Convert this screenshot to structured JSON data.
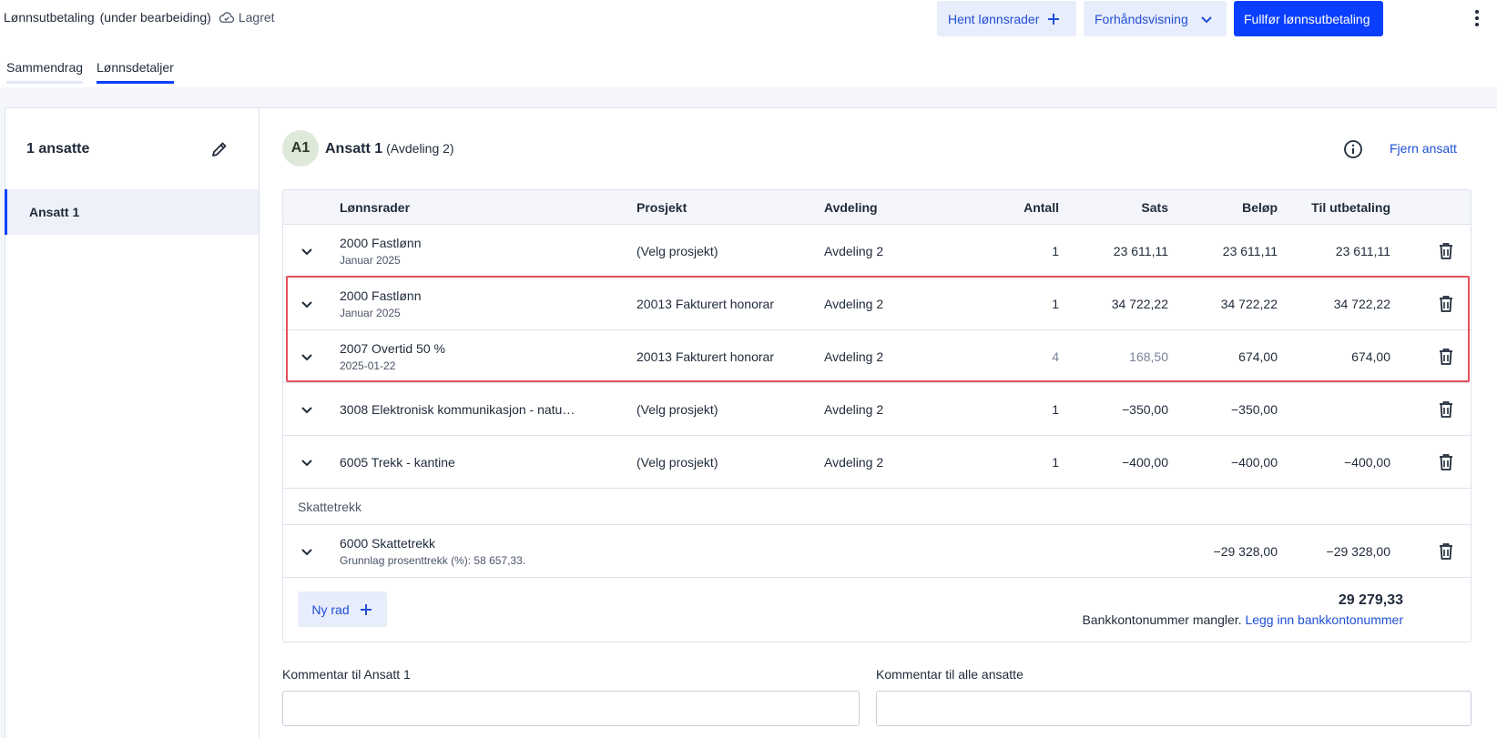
{
  "header": {
    "title": "Lønnsutbetaling",
    "title_status": "(under bearbeiding)",
    "save_status": "Lagret",
    "fetch_button": "Hent lønnsrader",
    "preview_button": "Forhåndsvisning",
    "finish_button": "Fullfør lønnsutbetaling"
  },
  "tabs": [
    {
      "label": "Sammendrag",
      "active": false
    },
    {
      "label": "Lønnsdetaljer",
      "active": true
    }
  ],
  "sidebar": {
    "count_label": "1 ansatte",
    "items": [
      {
        "label": "Ansatt 1",
        "selected": true
      }
    ]
  },
  "employee": {
    "initials": "A1",
    "name": "Ansatt 1",
    "department": "(Avdeling 2)",
    "remove_label": "Fjern ansatt"
  },
  "table": {
    "columns": [
      "Lønnsrader",
      "Prosjekt",
      "Avdeling",
      "Antall",
      "Sats",
      "Beløp",
      "Til utbetaling"
    ],
    "rows": [
      {
        "name": "2000 Fastlønn",
        "sub": "Januar 2025",
        "project": "(Velg prosjekt)",
        "department": "Avdeling 2",
        "qty": "1",
        "rate": "23 611,11",
        "amount": "23 611,11",
        "payout": "23 611,11"
      },
      {
        "name": "2000 Fastlønn",
        "sub": "Januar 2025",
        "project": "20013 Fakturert honorar",
        "department": "Avdeling 2",
        "qty": "1",
        "rate": "34 722,22",
        "amount": "34 722,22",
        "payout": "34 722,22"
      },
      {
        "name": "2007 Overtid 50 %",
        "sub": "2025-01-22",
        "project": "20013 Fakturert honorar",
        "department": "Avdeling 2",
        "qty": "4",
        "rate": "168,50",
        "amount": "674,00",
        "payout": "674,00"
      },
      {
        "name": "3008 Elektronisk kommunikasjon - natu…",
        "sub": "",
        "project": "(Velg prosjekt)",
        "department": "Avdeling 2",
        "qty": "1",
        "rate": "−350,00",
        "amount": "−350,00",
        "payout": ""
      },
      {
        "name": "6005 Trekk - kantine",
        "sub": "",
        "project": "(Velg prosjekt)",
        "department": "Avdeling 2",
        "qty": "1",
        "rate": "−400,00",
        "amount": "−400,00",
        "payout": "−400,00"
      }
    ],
    "tax_section_label": "Skattetrekk",
    "tax_row": {
      "name": "6000 Skattetrekk",
      "sub": "Grunnlag prosenttrekk (%): 58 657,33.",
      "amount": "−29 328,00",
      "payout": "−29 328,00"
    },
    "new_row_label": "Ny rad",
    "total": "29 279,33",
    "bank_missing_text": "Bankkontonummer mangler.",
    "bank_link": "Legg inn bankkontonummer"
  },
  "comments": {
    "employee_label": "Kommentar til Ansatt 1",
    "all_label": "Kommentar til alle ansatte",
    "employee_value": "",
    "all_value": ""
  },
  "colors": {
    "primary": "#0a3fff",
    "link": "#1f4fd6",
    "highlight_border": "#e8505f"
  }
}
